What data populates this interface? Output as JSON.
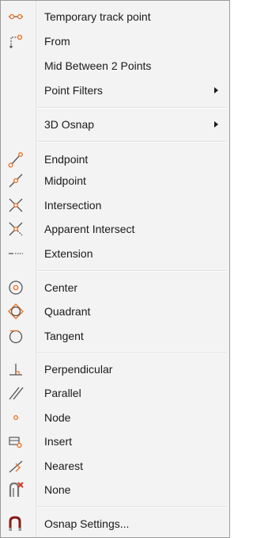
{
  "menu": {
    "accent_color": "#e8742c",
    "items": [
      {
        "label": "Temporary track point",
        "icon": "temporary-track-point-icon"
      },
      {
        "label": "From",
        "icon": "from-icon"
      },
      {
        "label": "Mid Between 2 Points",
        "icon": ""
      },
      {
        "label": "Point Filters",
        "icon": "",
        "submenu": true
      },
      {
        "label": "3D Osnap",
        "icon": "",
        "submenu": true
      },
      {
        "label": "Endpoint",
        "icon": "endpoint-icon"
      },
      {
        "label": "Midpoint",
        "icon": "midpoint-icon"
      },
      {
        "label": "Intersection",
        "icon": "intersection-icon"
      },
      {
        "label": "Apparent Intersect",
        "icon": "apparent-intersect-icon"
      },
      {
        "label": "Extension",
        "icon": "extension-icon"
      },
      {
        "label": "Center",
        "icon": "center-icon"
      },
      {
        "label": "Quadrant",
        "icon": "quadrant-icon"
      },
      {
        "label": "Tangent",
        "icon": "tangent-icon"
      },
      {
        "label": "Perpendicular",
        "icon": "perpendicular-icon"
      },
      {
        "label": "Parallel",
        "icon": "parallel-icon"
      },
      {
        "label": "Node",
        "icon": "node-icon"
      },
      {
        "label": "Insert",
        "icon": "insert-icon"
      },
      {
        "label": "Nearest",
        "icon": "nearest-icon"
      },
      {
        "label": "None",
        "icon": "none-icon"
      },
      {
        "label": "Osnap Settings...",
        "icon": "osnap-settings-icon"
      }
    ]
  }
}
